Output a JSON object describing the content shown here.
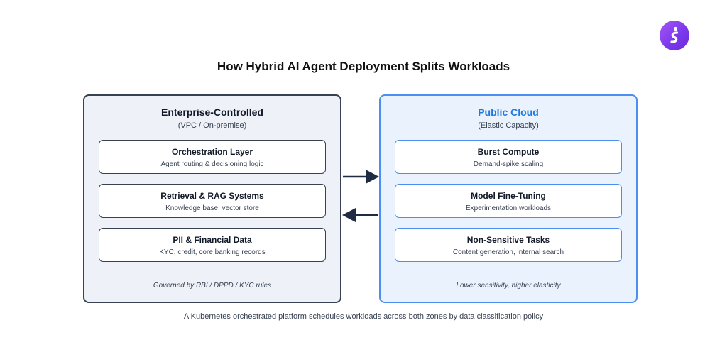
{
  "title": "How Hybrid AI Agent Deployment Splits Workloads",
  "colors": {
    "enterprise_border": "#374151",
    "cloud_border": "#4b8ff0",
    "cloud_title": "#1f7ae0",
    "logo_gradient": [
      "#a855f7",
      "#6d28d9"
    ]
  },
  "logo": {
    "icon": "s-logo-icon"
  },
  "enterprise": {
    "title": "Enterprise-Controlled",
    "subtitle": "(VPC / On-premise)",
    "cards": [
      {
        "title": "Orchestration Layer",
        "subtitle": "Agent routing & decisioning logic"
      },
      {
        "title": "Retrieval & RAG Systems",
        "subtitle": "Knowledge base, vector store"
      },
      {
        "title": "PII & Financial Data",
        "subtitle": "KYC, credit, core banking records"
      }
    ],
    "footer": "Governed by RBI / DPPD / KYC rules"
  },
  "cloud": {
    "title": "Public Cloud",
    "subtitle": "(Elastic Capacity)",
    "cards": [
      {
        "title": "Burst Compute",
        "subtitle": "Demand-spike scaling"
      },
      {
        "title": "Model Fine-Tuning",
        "subtitle": "Experimentation workloads"
      },
      {
        "title": "Non-Sensitive Tasks",
        "subtitle": "Content generation, internal search"
      }
    ],
    "footer": "Lower sensitivity, higher elasticity"
  },
  "arrows": [
    {
      "icon": "arrow-right-icon",
      "direction": "right"
    },
    {
      "icon": "arrow-left-icon",
      "direction": "left"
    }
  ],
  "caption": "A Kubernetes orchestrated platform schedules workloads across both zones by data classification policy"
}
